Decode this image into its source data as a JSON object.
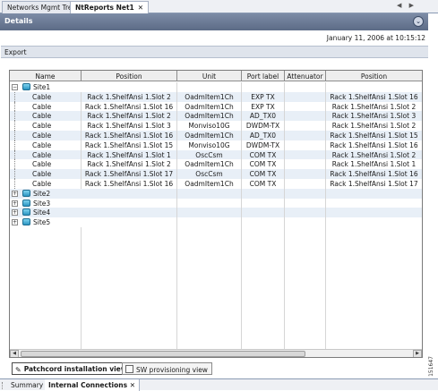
{
  "tabs": [
    {
      "label": "Networks Mgmt Tree",
      "active": false
    },
    {
      "label": "NtReports Net1",
      "active": true,
      "close": "✕"
    }
  ],
  "nav_arrows": "◀ ▶",
  "details": {
    "title": "Details",
    "collapse_icon": "⌄"
  },
  "report_date": "January 11, 2006 at 10:15:12",
  "export_label": "Export",
  "table": {
    "columns": [
      "Name",
      "Position",
      "Unit",
      "Port label",
      "Attenuator",
      "Position"
    ],
    "sites": [
      {
        "name": "Site1",
        "expanded": true,
        "expander": "−",
        "rows": [
          [
            "Cable",
            "Rack 1.ShelfAnsi 1.Slot 2",
            "OadmItem1Ch",
            "EXP TX",
            "",
            "Rack 1.ShelfAnsi 1.Slot 16"
          ],
          [
            "Cable",
            "Rack 1.ShelfAnsi 1.Slot 16",
            "OadmItem1Ch",
            "EXP TX",
            "",
            "Rack 1.ShelfAnsi 1.Slot 2"
          ],
          [
            "Cable",
            "Rack 1.ShelfAnsi 1.Slot 2",
            "OadmItem1Ch",
            "AD_TX0",
            "",
            "Rack 1.ShelfAnsi 1.Slot 3"
          ],
          [
            "Cable",
            "Rack 1.ShelfAnsi 1.Slot 3",
            "Monviso10G",
            "DWDM-TX",
            "",
            "Rack 1.ShelfAnsi 1.Slot 2"
          ],
          [
            "Cable",
            "Rack 1.ShelfAnsi 1.Slot 16",
            "OadmItem1Ch",
            "AD_TX0",
            "",
            "Rack 1.ShelfAnsi 1.Slot 15"
          ],
          [
            "Cable",
            "Rack 1.ShelfAnsi 1.Slot 15",
            "Monviso10G",
            "DWDM-TX",
            "",
            "Rack 1.ShelfAnsi 1.Slot 16"
          ],
          [
            "Cable",
            "Rack 1.ShelfAnsi 1.Slot 1",
            "OscCsm",
            "COM TX",
            "",
            "Rack 1.ShelfAnsi 1.Slot 2"
          ],
          [
            "Cable",
            "Rack 1.ShelfAnsi 1.Slot 2",
            "OadmItem1Ch",
            "COM TX",
            "",
            "Rack 1.ShelfAnsi 1.Slot 1"
          ],
          [
            "Cable",
            "Rack 1.ShelfAnsi 1.Slot 17",
            "OscCsm",
            "COM TX",
            "",
            "Rack 1.ShelfAnsi 1.Slot 16"
          ],
          [
            "Cable",
            "Rack 1.ShelfAnsi 1.Slot 16",
            "OadmItem1Ch",
            "COM TX",
            "",
            "Rack 1.ShelfAnsi 1.Slot 17"
          ]
        ]
      },
      {
        "name": "Site2",
        "expanded": false,
        "expander": "+"
      },
      {
        "name": "Site3",
        "expanded": false,
        "expander": "+"
      },
      {
        "name": "Site4",
        "expanded": false,
        "expander": "+"
      },
      {
        "name": "Site5",
        "expanded": false,
        "expander": "+"
      }
    ]
  },
  "scroll_arrows": {
    "left": "◀",
    "right": "▶"
  },
  "view_tabs": [
    {
      "label": "Patchcord installation view",
      "active": true,
      "icon": "pencil-icon",
      "glyph": "✎"
    },
    {
      "label": "SW provisioning view",
      "active": false,
      "icon": "provisioning-icon"
    }
  ],
  "figure_id": "151647",
  "bottom_tabs": [
    {
      "label": "Summary",
      "active": false
    },
    {
      "label": "Internal Connections",
      "active": true,
      "close": "✕"
    }
  ],
  "colors": {
    "header_bar": "#6b7a95",
    "alt_row": "#e8eff7",
    "site_icon": "#2b95c2"
  }
}
